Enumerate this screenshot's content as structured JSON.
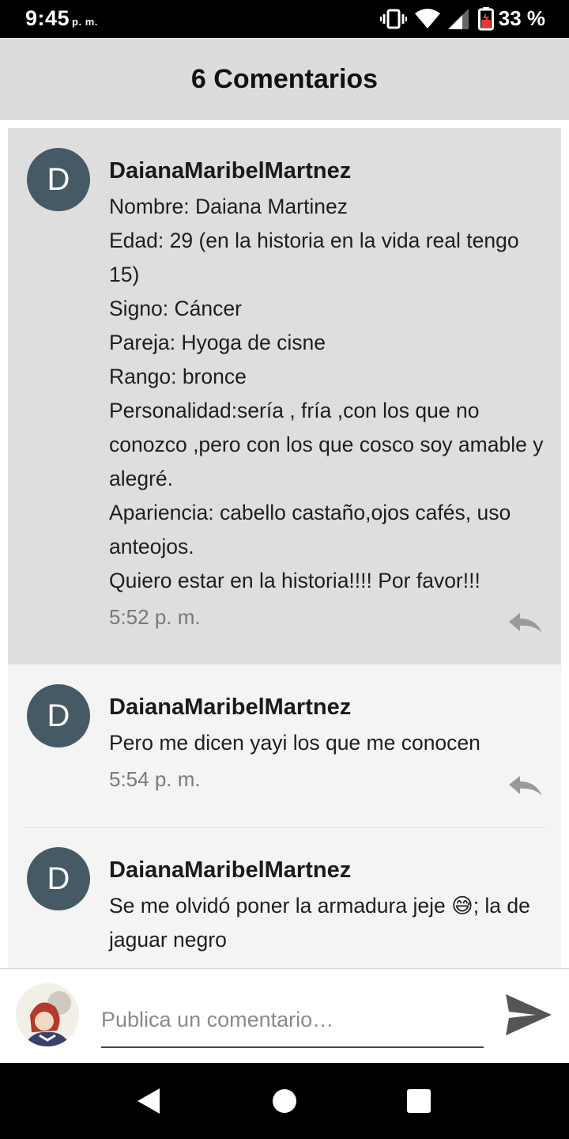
{
  "status_bar": {
    "time": "9:45",
    "ampm": "p. m.",
    "battery": "33 %",
    "icons": [
      "vibrate-icon",
      "wifi-icon",
      "signal-icon",
      "battery-icon"
    ]
  },
  "header": {
    "title": "6 Comentarios"
  },
  "comments": [
    {
      "avatar_letter": "D",
      "author": "DaianaMaribelMartnez",
      "lines": [
        "Nombre: Daiana Martinez",
        "Edad: 29 (en la historia en la vida real tengo 15)",
        "Signo: Cáncer",
        "Pareja: Hyoga de cisne",
        "Rango: bronce",
        "Personalidad:sería , fría ,con los que no conozco ,pero con los que cosco soy amable y alegré.",
        "Apariencia: cabello castaño,ojos cafés, uso anteojos.",
        "Quiero estar en la historia!!!! Por favor!!!"
      ],
      "time": "5:52 p. m."
    },
    {
      "avatar_letter": "D",
      "author": "DaianaMaribelMartnez",
      "lines": [
        "Pero me dicen yayi los que me conocen"
      ],
      "time": "5:54 p. m."
    },
    {
      "avatar_letter": "D",
      "author": "DaianaMaribelMartnez",
      "lines": [
        "Se me olvidó poner la armadura jeje 😅; la de jaguar negro"
      ]
    }
  ],
  "composer": {
    "placeholder": "Publica un comentario…"
  },
  "colors": {
    "avatar_bg": "#455a64",
    "highlight_bg": "#dedede",
    "header_bg": "#dcdcdc"
  }
}
